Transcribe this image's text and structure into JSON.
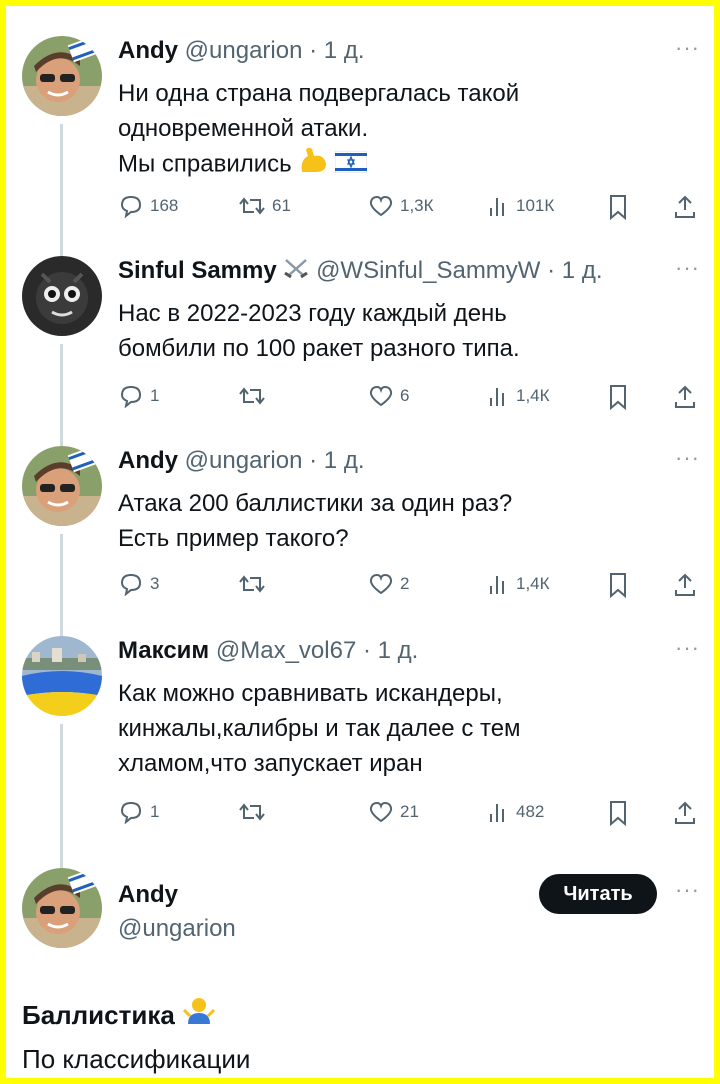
{
  "tweets": [
    {
      "name": "Andy",
      "handle": "@ungarion",
      "sep": "·",
      "time": "1 д.",
      "lines": [
        "Ни одна страна подвергалась такой",
        "одновременной атаки.",
        "Мы справились"
      ],
      "replies": "168",
      "retweets": "61",
      "likes": "1,3К",
      "views": "101К"
    },
    {
      "name": "Sinful Sammy",
      "handle": "@WSinful_SammyW",
      "sep": "·",
      "time": "1 д.",
      "lines": [
        "Нас в 2022-2023 году каждый день",
        "бомбили по 100 ракет разного типа."
      ],
      "replies": "1",
      "retweets": "",
      "likes": "6",
      "views": "1,4К"
    },
    {
      "name": "Andy",
      "handle": "@ungarion",
      "sep": "·",
      "time": "1 д.",
      "lines": [
        "Атака 200 баллистики за один раз?",
        "Есть пример такого?"
      ],
      "replies": "3",
      "retweets": "",
      "likes": "2",
      "views": "1,4К"
    },
    {
      "name": "Максим",
      "handle": "@Max_vol67",
      "sep": "·",
      "time": "1 д.",
      "lines": [
        "Как можно сравнивать искандеры,",
        "кинжалы,калибры и так далее с тем",
        "хламом,что запускает иран"
      ],
      "replies": "1",
      "retweets": "",
      "likes": "21",
      "views": "482"
    }
  ],
  "main_post": {
    "name": "Andy",
    "handle": "@ungarion",
    "follow_label": "Читать",
    "lines": [
      "Баллистика",
      "По классификации"
    ]
  },
  "more_label": "···",
  "colors": {
    "accent": "#0f1419",
    "muted": "#536471",
    "thread": "#cfd9de",
    "border_frame": "#ffff00"
  },
  "icons": [
    "reply-icon",
    "retweet-icon",
    "like-icon",
    "views-icon",
    "bookmark-icon",
    "share-icon",
    "flexed-biceps-emoji",
    "israel-flag-emoji",
    "crossed-swords-emoji",
    "shrugging-emoji"
  ]
}
